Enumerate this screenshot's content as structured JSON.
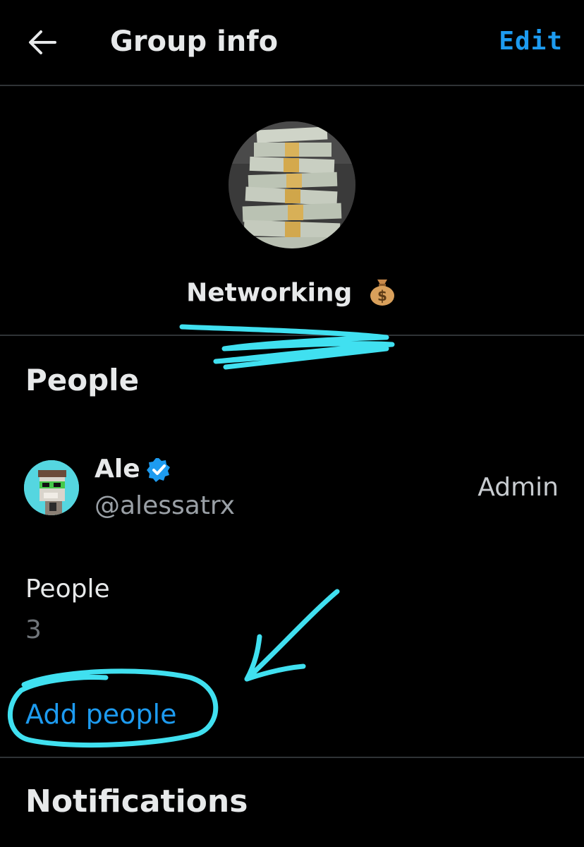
{
  "header": {
    "title": "Group info",
    "edit_label": "Edit"
  },
  "group": {
    "name": "Networking",
    "name_emoji": "money-bag-icon"
  },
  "people_section": {
    "title": "People",
    "members": [
      {
        "name": "Ale",
        "handle": "@alessatrx",
        "verified": true,
        "role": "Admin"
      }
    ],
    "count_label": "People",
    "count_value": "3",
    "add_label": "Add people"
  },
  "notifications_section": {
    "title": "Notifications"
  },
  "colors": {
    "background": "#000000",
    "accent": "#1d9bf0",
    "text_primary": "#e7e9ea",
    "text_secondary": "#71767b",
    "annotation": "#40e0f0"
  }
}
